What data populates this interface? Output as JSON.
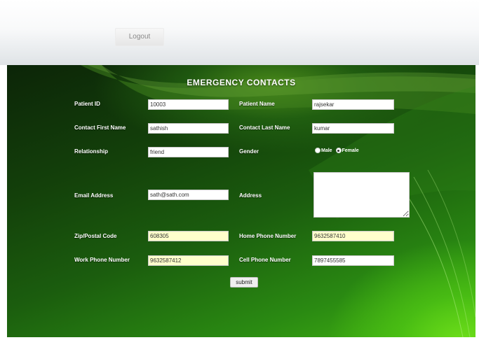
{
  "header": {
    "logout_label": "Logout"
  },
  "form": {
    "title": "EMERGENCY CONTACTS",
    "patient_id": {
      "label": "Patient ID",
      "value": "10003"
    },
    "patient_name": {
      "label": "Patient Name",
      "value": "rajsekar"
    },
    "contact_first_name": {
      "label": "Contact First Name",
      "value": "sathish"
    },
    "contact_last_name": {
      "label": "Contact Last Name",
      "value": "kumar"
    },
    "relationship": {
      "label": "Relationship",
      "value": "friend"
    },
    "gender": {
      "label": "Gender",
      "options": [
        "Male",
        "Female"
      ],
      "selected": "Female"
    },
    "email": {
      "label": "Email Address",
      "value": "sath@sath.com"
    },
    "address": {
      "label": "Address",
      "value": ""
    },
    "zip": {
      "label": "Zip/Postal Code",
      "value": "608305"
    },
    "home_phone": {
      "label": "Home Phone Number",
      "value": "9632587410"
    },
    "work_phone": {
      "label": "Work Phone Number",
      "value": "9632587412"
    },
    "cell_phone": {
      "label": "Cell Phone Number",
      "value": "7897455585"
    },
    "submit_label": "submit"
  },
  "colors": {
    "panel_dark": "#0c2508",
    "panel_light": "#6fe01a",
    "autofill_field": "#ffffcc",
    "label_text": "#ffffff"
  }
}
